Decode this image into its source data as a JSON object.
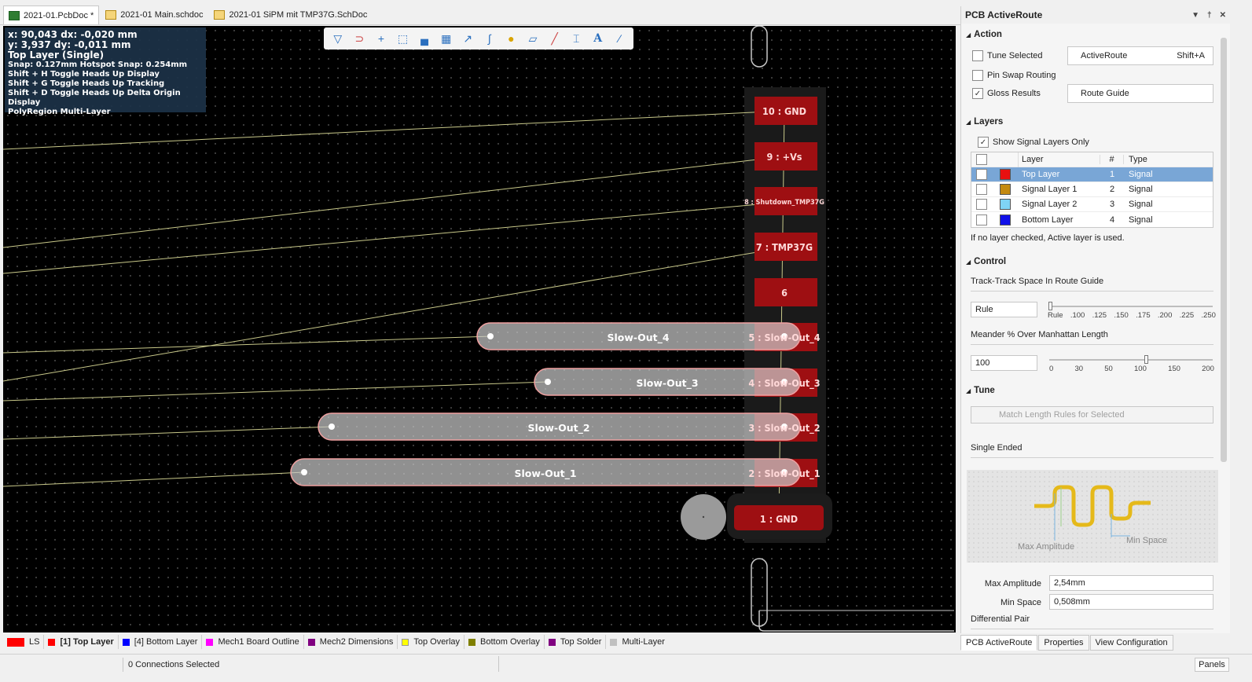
{
  "doc_tabs": [
    {
      "label": "2021-01.PcbDoc *",
      "icon": "pcb-doc-icon",
      "active": true
    },
    {
      "label": "2021-01 Main.schdoc",
      "icon": "sch-doc-icon",
      "active": false
    },
    {
      "label": "2021-01 SiPM mit TMP37G.SchDoc",
      "icon": "sch-doc-icon",
      "active": false
    }
  ],
  "hud": {
    "line1": "x: 90,043   dx: -0,020 mm",
    "line2": "y:  3,937    dy: -0,011  mm",
    "layer": "Top Layer (Single)",
    "snap": "Snap: 0.127mm Hotspot Snap: 0.254mm",
    "h1": "Shift + H  Toggle Heads Up Display",
    "h2": "Shift + G  Toggle Heads Up Tracking",
    "h3": "Shift + D  Toggle Heads Up Delta Origin Display",
    "poly": "PolyRegion    Multi-Layer"
  },
  "pcb_toolbar": [
    "filter-icon",
    "interactive-route-icon",
    "place-cross-icon",
    "select-rect-icon",
    "align-icon",
    "component-icon",
    "route-icon",
    "diff-pair-icon",
    "pin-icon",
    "polygon-icon",
    "via-icon",
    "dimension-icon",
    "text-icon",
    "line-icon"
  ],
  "pads": {
    "pin10": "10 : GND",
    "pin9": "9 : +Vs",
    "pin8": "8 : Shutdown_TMP37G",
    "pin7": "7 : TMP37G",
    "pin6": "6",
    "pin5": "5 : Slow-Out_4",
    "pin4": "4 : Slow-Out_3",
    "pin3": "3 : Slow-Out_2",
    "pin2": "2 : Slow-Out_1",
    "pin1": "1 : GND"
  },
  "tracks": {
    "t4": "Slow-Out_4",
    "t3": "Slow-Out_3",
    "t2": "Slow-Out_2",
    "t1": "Slow-Out_1"
  },
  "layer_tabs": [
    {
      "label": "LS",
      "color": "#ff0000"
    },
    {
      "label": "[1] Top Layer",
      "color": "#ff0000",
      "active": true
    },
    {
      "label": "[4] Bottom Layer",
      "color": "#0000ff"
    },
    {
      "label": "Mech1 Board Outline",
      "color": "#ff00ff"
    },
    {
      "label": "Mech2 Dimensions",
      "color": "#800080"
    },
    {
      "label": "Top Overlay",
      "color": "#ffff00"
    },
    {
      "label": "Bottom Overlay",
      "color": "#808000"
    },
    {
      "label": "Top Solder",
      "color": "#800080"
    },
    {
      "label": "Multi-Layer",
      "color": "#c0c0c0"
    }
  ],
  "status": {
    "connections": "0 Connections Selected",
    "panels": "Panels"
  },
  "panel": {
    "title": "PCB ActiveRoute",
    "action": {
      "title": "Action",
      "tune_selected": "Tune Selected",
      "pin_swap": "Pin Swap Routing",
      "gloss": "Gloss Results",
      "activeroute_btn": "ActiveRoute",
      "shortcut": "Shift+A",
      "route_guide_btn": "Route Guide"
    },
    "layers": {
      "title": "Layers",
      "show_signal": "Show Signal Layers Only",
      "col_layer": "Layer",
      "col_num": "#",
      "col_type": "Type",
      "rows": [
        {
          "name": "Top Layer",
          "num": "1",
          "type": "Signal",
          "color": "#e81010"
        },
        {
          "name": "Signal Layer 1",
          "num": "2",
          "type": "Signal",
          "color": "#c48a10"
        },
        {
          "name": "Signal Layer 2",
          "num": "3",
          "type": "Signal",
          "color": "#7fd4f5"
        },
        {
          "name": "Bottom Layer",
          "num": "4",
          "type": "Signal",
          "color": "#1010e8"
        }
      ],
      "note": "If no layer checked, Active layer is used."
    },
    "control": {
      "title": "Control",
      "track_space_label": "Track-Track Space In Route Guide",
      "track_space_value": "Rule",
      "track_space_ticks": [
        "Rule",
        ".100",
        ".125",
        ".150",
        ".175",
        ".200",
        ".225",
        ".250"
      ],
      "meander_label": "Meander % Over Manhattan Length",
      "meander_value": "100",
      "meander_ticks": [
        "0",
        "30",
        "50",
        "100",
        "150",
        "200"
      ]
    },
    "tune": {
      "title": "Tune",
      "match_btn": "Match Length Rules for Selected",
      "single_ended": "Single Ended",
      "diagram_max": "Max Amplitude",
      "diagram_min": "Min Space",
      "max_amp_label": "Max Amplitude",
      "max_amp_value": "2,54mm",
      "min_space_label": "Min Space",
      "min_space_value": "0,508mm",
      "diff_pair": "Differential Pair"
    },
    "tabs": [
      "PCB ActiveRoute",
      "Properties",
      "View Configuration"
    ]
  }
}
